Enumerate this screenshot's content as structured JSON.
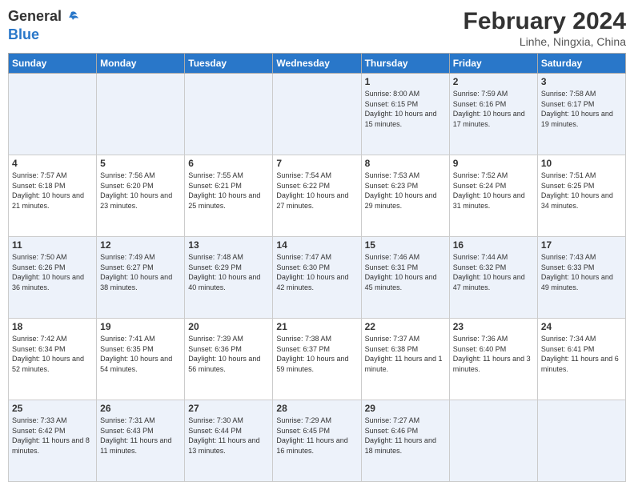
{
  "header": {
    "logo_line1": "General",
    "logo_line2": "Blue",
    "title": "February 2024",
    "subtitle": "Linhe, Ningxia, China"
  },
  "days_of_week": [
    "Sunday",
    "Monday",
    "Tuesday",
    "Wednesday",
    "Thursday",
    "Friday",
    "Saturday"
  ],
  "weeks": [
    [
      {
        "day": "",
        "info": ""
      },
      {
        "day": "",
        "info": ""
      },
      {
        "day": "",
        "info": ""
      },
      {
        "day": "",
        "info": ""
      },
      {
        "day": "1",
        "info": "Sunrise: 8:00 AM\nSunset: 6:15 PM\nDaylight: 10 hours\nand 15 minutes."
      },
      {
        "day": "2",
        "info": "Sunrise: 7:59 AM\nSunset: 6:16 PM\nDaylight: 10 hours\nand 17 minutes."
      },
      {
        "day": "3",
        "info": "Sunrise: 7:58 AM\nSunset: 6:17 PM\nDaylight: 10 hours\nand 19 minutes."
      }
    ],
    [
      {
        "day": "4",
        "info": "Sunrise: 7:57 AM\nSunset: 6:18 PM\nDaylight: 10 hours\nand 21 minutes."
      },
      {
        "day": "5",
        "info": "Sunrise: 7:56 AM\nSunset: 6:20 PM\nDaylight: 10 hours\nand 23 minutes."
      },
      {
        "day": "6",
        "info": "Sunrise: 7:55 AM\nSunset: 6:21 PM\nDaylight: 10 hours\nand 25 minutes."
      },
      {
        "day": "7",
        "info": "Sunrise: 7:54 AM\nSunset: 6:22 PM\nDaylight: 10 hours\nand 27 minutes."
      },
      {
        "day": "8",
        "info": "Sunrise: 7:53 AM\nSunset: 6:23 PM\nDaylight: 10 hours\nand 29 minutes."
      },
      {
        "day": "9",
        "info": "Sunrise: 7:52 AM\nSunset: 6:24 PM\nDaylight: 10 hours\nand 31 minutes."
      },
      {
        "day": "10",
        "info": "Sunrise: 7:51 AM\nSunset: 6:25 PM\nDaylight: 10 hours\nand 34 minutes."
      }
    ],
    [
      {
        "day": "11",
        "info": "Sunrise: 7:50 AM\nSunset: 6:26 PM\nDaylight: 10 hours\nand 36 minutes."
      },
      {
        "day": "12",
        "info": "Sunrise: 7:49 AM\nSunset: 6:27 PM\nDaylight: 10 hours\nand 38 minutes."
      },
      {
        "day": "13",
        "info": "Sunrise: 7:48 AM\nSunset: 6:29 PM\nDaylight: 10 hours\nand 40 minutes."
      },
      {
        "day": "14",
        "info": "Sunrise: 7:47 AM\nSunset: 6:30 PM\nDaylight: 10 hours\nand 42 minutes."
      },
      {
        "day": "15",
        "info": "Sunrise: 7:46 AM\nSunset: 6:31 PM\nDaylight: 10 hours\nand 45 minutes."
      },
      {
        "day": "16",
        "info": "Sunrise: 7:44 AM\nSunset: 6:32 PM\nDaylight: 10 hours\nand 47 minutes."
      },
      {
        "day": "17",
        "info": "Sunrise: 7:43 AM\nSunset: 6:33 PM\nDaylight: 10 hours\nand 49 minutes."
      }
    ],
    [
      {
        "day": "18",
        "info": "Sunrise: 7:42 AM\nSunset: 6:34 PM\nDaylight: 10 hours\nand 52 minutes."
      },
      {
        "day": "19",
        "info": "Sunrise: 7:41 AM\nSunset: 6:35 PM\nDaylight: 10 hours\nand 54 minutes."
      },
      {
        "day": "20",
        "info": "Sunrise: 7:39 AM\nSunset: 6:36 PM\nDaylight: 10 hours\nand 56 minutes."
      },
      {
        "day": "21",
        "info": "Sunrise: 7:38 AM\nSunset: 6:37 PM\nDaylight: 10 hours\nand 59 minutes."
      },
      {
        "day": "22",
        "info": "Sunrise: 7:37 AM\nSunset: 6:38 PM\nDaylight: 11 hours\nand 1 minute."
      },
      {
        "day": "23",
        "info": "Sunrise: 7:36 AM\nSunset: 6:40 PM\nDaylight: 11 hours\nand 3 minutes."
      },
      {
        "day": "24",
        "info": "Sunrise: 7:34 AM\nSunset: 6:41 PM\nDaylight: 11 hours\nand 6 minutes."
      }
    ],
    [
      {
        "day": "25",
        "info": "Sunrise: 7:33 AM\nSunset: 6:42 PM\nDaylight: 11 hours\nand 8 minutes."
      },
      {
        "day": "26",
        "info": "Sunrise: 7:31 AM\nSunset: 6:43 PM\nDaylight: 11 hours\nand 11 minutes."
      },
      {
        "day": "27",
        "info": "Sunrise: 7:30 AM\nSunset: 6:44 PM\nDaylight: 11 hours\nand 13 minutes."
      },
      {
        "day": "28",
        "info": "Sunrise: 7:29 AM\nSunset: 6:45 PM\nDaylight: 11 hours\nand 16 minutes."
      },
      {
        "day": "29",
        "info": "Sunrise: 7:27 AM\nSunset: 6:46 PM\nDaylight: 11 hours\nand 18 minutes."
      },
      {
        "day": "",
        "info": ""
      },
      {
        "day": "",
        "info": ""
      }
    ]
  ]
}
